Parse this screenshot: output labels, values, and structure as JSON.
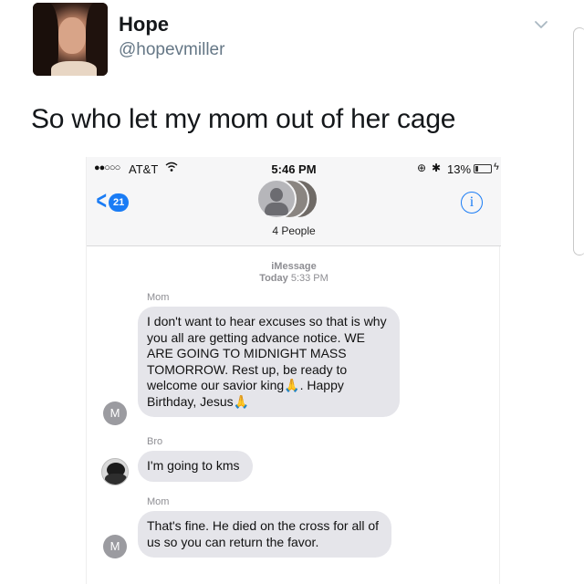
{
  "tweet": {
    "name": "Hope",
    "handle": "@hopevmiller",
    "text": "So who let my mom out of her cage"
  },
  "phone": {
    "status": {
      "signal": "●●○○○",
      "carrier": "AT&T",
      "wifi_icon": "wifi-icon",
      "time": "5:46 PM",
      "battery": "13%"
    },
    "nav": {
      "back_count": "21",
      "group_label": "4 People",
      "info_glyph": "i"
    },
    "thread_header": {
      "service": "iMessage",
      "day": "Today",
      "time": "5:33 PM"
    },
    "messages": [
      {
        "sender": "Mom",
        "avatar_initial": "M",
        "lines": [
          "I don't want to hear excuses so that is why",
          "you all are getting advance notice.  WE",
          "ARE GOING TO MIDNIGHT MASS",
          "TOMORROW.  Rest up, be ready to",
          "welcome our savior king",
          ". Happy",
          "Birthday, Jesus"
        ]
      },
      {
        "sender": "Bro",
        "text": "I'm going to kms"
      },
      {
        "sender": "Mom",
        "avatar_initial": "M",
        "lines": [
          "That's fine.  He died on the cross for all of",
          "us so you can return the favor."
        ]
      }
    ],
    "emoji": "🙏"
  }
}
